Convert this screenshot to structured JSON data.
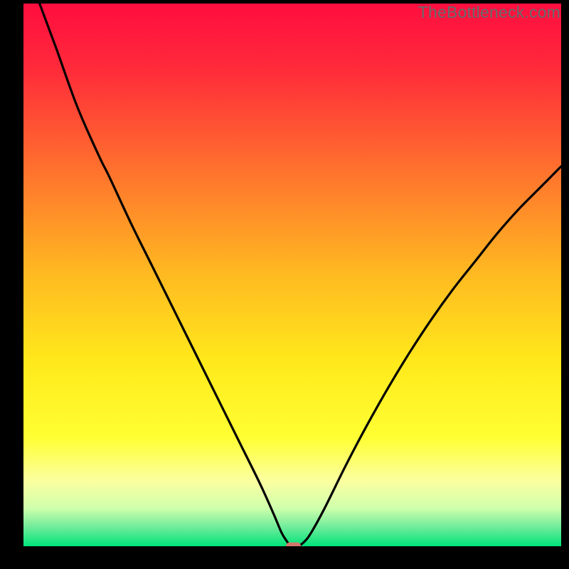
{
  "watermark": {
    "text": "TheBottleneck.com"
  },
  "layout": {
    "outer_w": 800,
    "outer_h": 800,
    "margin_left": 33,
    "margin_right": 11,
    "margin_top": 5,
    "margin_bottom": 32,
    "watermark_right_offset": 12,
    "watermark_top_offset": 4
  },
  "chart_data": {
    "type": "line",
    "title": "",
    "xlabel": "",
    "ylabel": "",
    "xlim": [
      0,
      100
    ],
    "ylim": [
      0,
      100
    ],
    "gradient_stops": [
      {
        "pos": 0.0,
        "color": "#ff0e3f"
      },
      {
        "pos": 0.12,
        "color": "#ff2a3a"
      },
      {
        "pos": 0.3,
        "color": "#ff6f2e"
      },
      {
        "pos": 0.5,
        "color": "#ffba21"
      },
      {
        "pos": 0.66,
        "color": "#ffe91b"
      },
      {
        "pos": 0.8,
        "color": "#ffff33"
      },
      {
        "pos": 0.88,
        "color": "#fbffa0"
      },
      {
        "pos": 0.93,
        "color": "#cfffac"
      },
      {
        "pos": 0.965,
        "color": "#6eec9a"
      },
      {
        "pos": 1.0,
        "color": "#00e47a"
      }
    ],
    "curve": [
      {
        "x": 3.0,
        "y": 100.0
      },
      {
        "x": 6.0,
        "y": 92.0
      },
      {
        "x": 10.0,
        "y": 81.0
      },
      {
        "x": 14.0,
        "y": 72.0
      },
      {
        "x": 16.0,
        "y": 68.0
      },
      {
        "x": 20.0,
        "y": 59.5
      },
      {
        "x": 24.0,
        "y": 51.5
      },
      {
        "x": 28.0,
        "y": 43.5
      },
      {
        "x": 32.0,
        "y": 35.5
      },
      {
        "x": 36.0,
        "y": 27.5
      },
      {
        "x": 40.0,
        "y": 19.5
      },
      {
        "x": 44.0,
        "y": 11.5
      },
      {
        "x": 46.5,
        "y": 6.0
      },
      {
        "x": 48.0,
        "y": 2.5
      },
      {
        "x": 49.0,
        "y": 0.9
      },
      {
        "x": 49.7,
        "y": 0.0
      },
      {
        "x": 51.0,
        "y": 0.0
      },
      {
        "x": 52.2,
        "y": 0.8
      },
      {
        "x": 53.5,
        "y": 2.5
      },
      {
        "x": 56.0,
        "y": 7.0
      },
      {
        "x": 60.0,
        "y": 15.0
      },
      {
        "x": 64.0,
        "y": 22.5
      },
      {
        "x": 68.0,
        "y": 29.5
      },
      {
        "x": 72.0,
        "y": 36.0
      },
      {
        "x": 76.0,
        "y": 42.0
      },
      {
        "x": 80.0,
        "y": 47.5
      },
      {
        "x": 84.0,
        "y": 52.5
      },
      {
        "x": 88.0,
        "y": 57.5
      },
      {
        "x": 92.0,
        "y": 62.0
      },
      {
        "x": 96.0,
        "y": 66.0
      },
      {
        "x": 100.0,
        "y": 70.0
      }
    ],
    "marker": {
      "x": 50.2,
      "y": 0.0,
      "w": 2.8,
      "h": 1.4,
      "color": "#d3776a"
    },
    "curve_stroke": "#000000",
    "curve_stroke_width": 3.2
  }
}
